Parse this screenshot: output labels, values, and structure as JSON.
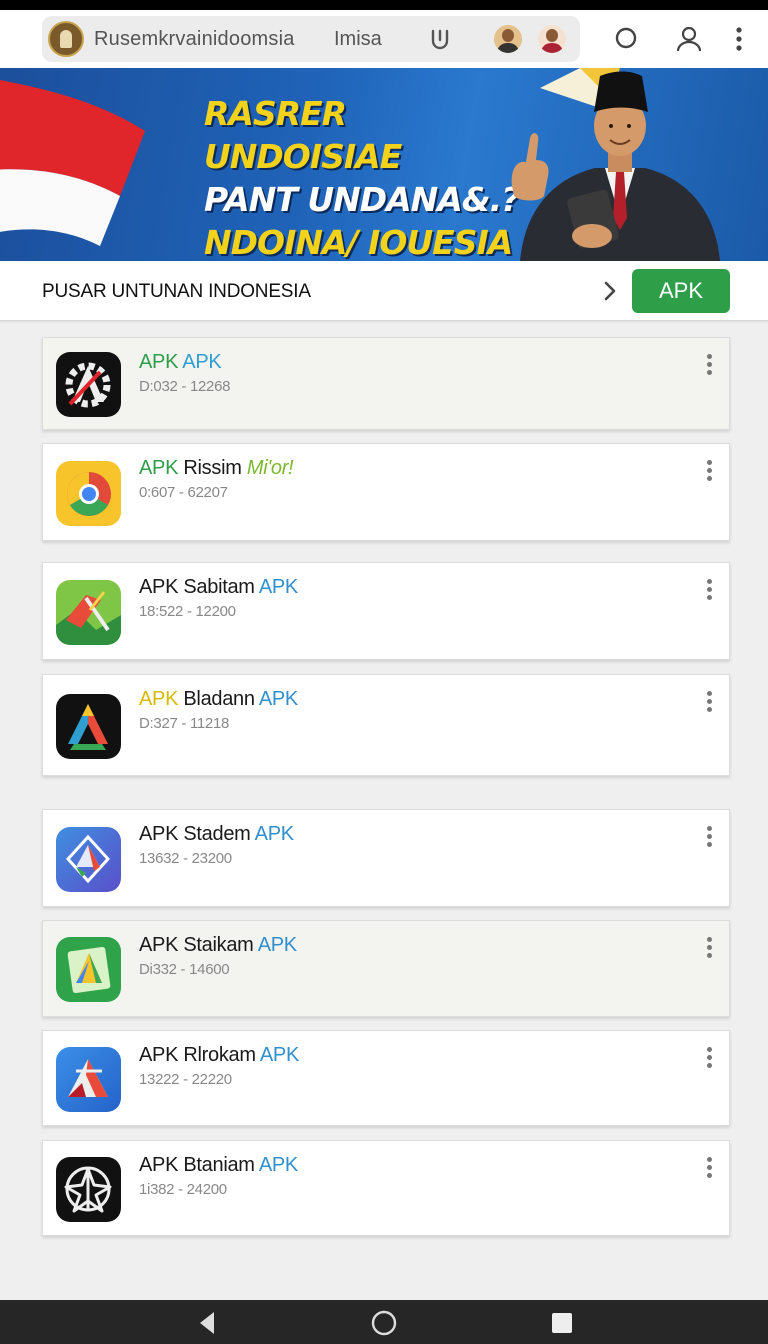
{
  "browser": {
    "url_text": "Rusemkrvainidoomsia",
    "url_extra": "Imisa"
  },
  "banner": {
    "line1": "RASRER UNDOISIAE",
    "line2": "PANT UNDANA&.?",
    "line3": "NDOINA/ IOUESIA"
  },
  "section": {
    "title": "PUSAR UNTUNAN INDONESIA",
    "button_label": "APK"
  },
  "apps": [
    {
      "name_a": "APK",
      "name_b": " ",
      "name_c": "APK",
      "meta": "D:032 - 12268",
      "icon": "vector-gear-icon",
      "a_color": "#2e9e48",
      "c_color": "#2f9fd0"
    },
    {
      "name_a": "APK",
      "name_b": " Rissim ",
      "name_c": "Mi'or!",
      "meta": "0:607 - 62207",
      "icon": "chrome-icon",
      "a_color": "#2e9e48",
      "c_color": "#7cb82f"
    },
    {
      "name_a": "APK",
      "name_b": " Sabitam ",
      "name_c": "APK",
      "meta": "18:522 - 12200",
      "icon": "maps-icon",
      "a_color": "#1a1a1a",
      "c_color": "#2f8fcf"
    },
    {
      "name_a": "APK",
      "name_b": " Bladann ",
      "name_c": "APK",
      "meta": "D:327 - 11218",
      "icon": "drive-icon",
      "a_color": "#d8b800",
      "c_color": "#2f8fcf"
    },
    {
      "name_a": "APK",
      "name_b": " Stadem ",
      "name_c": "APK",
      "meta": "13632 - 23200",
      "icon": "diamond-logo-icon",
      "a_color": "#1a1a1a",
      "c_color": "#2f8fcf"
    },
    {
      "name_a": "APK",
      "name_b": " Staikam ",
      "name_c": "APK",
      "meta": "Di332 - 14600",
      "icon": "green-drive-icon",
      "a_color": "#1a1a1a",
      "c_color": "#2f8fcf"
    },
    {
      "name_a": "APK",
      "name_b": " Rlrokam ",
      "name_c": "APK",
      "meta": "13222 - 22220",
      "icon": "red-triangle-icon",
      "a_color": "#1a1a1a",
      "c_color": "#2f8fcf"
    },
    {
      "name_a": "APK",
      "name_b": " Btaniam ",
      "name_c": "APK",
      "meta": "1i382 - 24200",
      "icon": "star-emblem-icon",
      "a_color": "#1a1a1a",
      "c_color": "#2f8fcf"
    }
  ],
  "colors": {
    "accent_green": "#2e9e48",
    "link_blue": "#2f8fcf",
    "banner_yellow": "#f2d21a"
  }
}
